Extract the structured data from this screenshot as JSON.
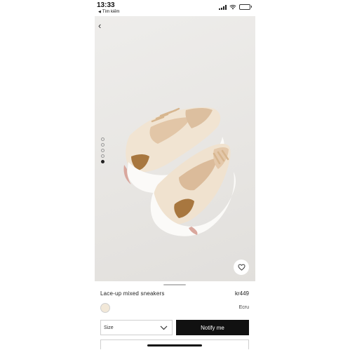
{
  "status_bar": {
    "time": "13:33",
    "back_label": "Tìm kiếm",
    "back_glyph": "◀"
  },
  "gallery": {
    "back_glyph": "‹",
    "dot_count": 5,
    "active_index": 4
  },
  "product": {
    "name": "Lace-up mixed sneakers",
    "price": "kr449",
    "color_name": "Ecru",
    "swatch_color": "#f2e8d8"
  },
  "actions": {
    "size_label": "Size",
    "notify_label": "Notify me"
  },
  "colors": {
    "button_bg": "#111111",
    "image_bg": "#e7e5e2"
  },
  "icons": {
    "favorite": "heart-icon",
    "back": "chevron-left-icon",
    "dropdown": "chevron-down-icon"
  }
}
